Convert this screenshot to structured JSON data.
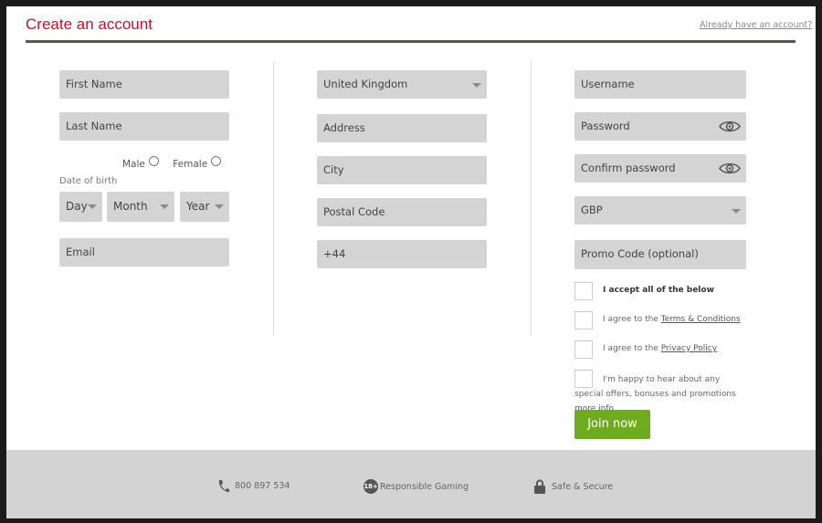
{
  "header": {
    "title": "Create an account",
    "login_link": "Already have an account?"
  },
  "col1": {
    "first_name": "First Name",
    "last_name": "Last Name",
    "gender": {
      "male": "Male",
      "female": "Female"
    },
    "dob_label": "Date of birth",
    "day": "Day",
    "month": "Month",
    "year": "Year",
    "email": "Email"
  },
  "col2": {
    "country": "United Kingdom",
    "address": "Address",
    "city": "City",
    "postal": "Postal Code",
    "phone": "+44"
  },
  "col3": {
    "username": "Username",
    "password": "Password",
    "confirm": "Confirm password",
    "currency": "GBP",
    "promo": "Promo Code (optional)"
  },
  "consents": {
    "accept_all": "I accept all of the below",
    "terms_prefix": "I agree to the ",
    "terms_link": "Terms & Conditions",
    "privacy_prefix": "I agree to the ",
    "privacy_link": "Privacy Policy",
    "offers_text": "I'm happy to hear about any special offers, bonuses and promotions",
    "more_info": "more info"
  },
  "join_button": "Join now",
  "footer": {
    "phone": "800 897 534",
    "age_badge": "18+",
    "responsible": "Responsible Gaming",
    "secure": "Safe & Secure"
  },
  "colors": {
    "brand_red": "#c4102c",
    "join_green": "#6eac1f",
    "field_gray": "#d4d4d4"
  }
}
